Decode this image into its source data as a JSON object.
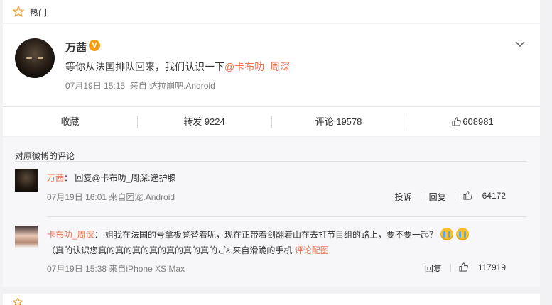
{
  "section_header": {
    "label": "热门"
  },
  "post": {
    "author": "万茜",
    "verified_badge": "V",
    "text_prefix": "等你从法国排队回来，我们认识一下",
    "mention": "@卡布叻_周深",
    "time": "07月19日 15:15",
    "source": "来自 达拉崩吧.Android"
  },
  "actions": {
    "favorite": "收藏",
    "repost": "转发 9224",
    "comment": "评论 19578",
    "like": "608981"
  },
  "comments": {
    "title": "对原微博的评论",
    "items": [
      {
        "name": "万茜",
        "colon": "：",
        "text_prefix": "回复",
        "mention": "@卡布叻_周深",
        "text_suffix": ":递护膝",
        "time": "07月19日 16:01 来自团宠.Android",
        "report": "投诉",
        "reply": "回复",
        "likes": "64172"
      },
      {
        "name": "卡布叻_周深",
        "colon": "：",
        "text": "姐我在法国的号拿板凳替着呢，现在正带着剑翻着山在去打节目组的路上，要不要一起？",
        "line2": "（真的认识您真的真的真的真的真的真的真的ごƨ.来自滑跪的手机",
        "link": "评论配图",
        "time": "07月19日 15:38 来自iPhone XS Max",
        "reply": "回复",
        "likes": "117919"
      }
    ]
  },
  "colors": {
    "accent": "#eb7350",
    "verified": "#f39b14",
    "link_blue": "#eb7350"
  }
}
